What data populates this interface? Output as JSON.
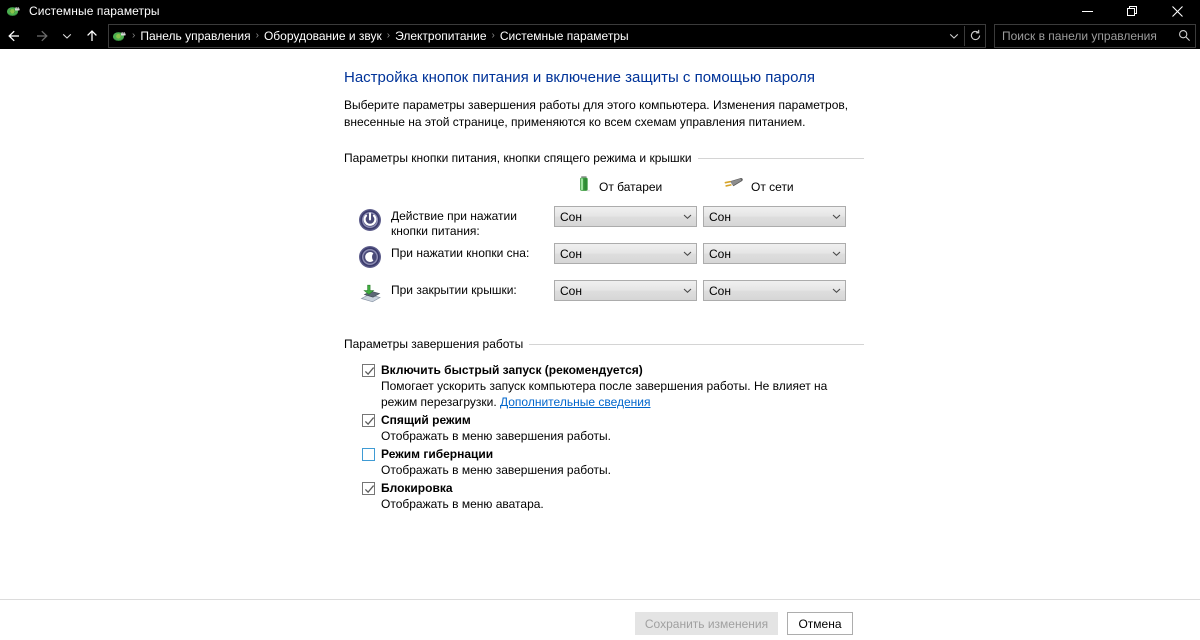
{
  "window": {
    "title": "Системные параметры",
    "icon": "power-options-icon",
    "caption": {
      "minimize": "minimize-icon",
      "maximize": "restore-icon",
      "close": "close-icon"
    }
  },
  "navbar": {
    "back": "back-arrow-icon",
    "forward": "forward-arrow-icon",
    "recent": "chevron-down-icon",
    "up": "up-arrow-icon",
    "address_icon": "power-options-icon",
    "breadcrumbs": [
      "Панель управления",
      "Оборудование и звук",
      "Электропитание",
      "Системные параметры"
    ],
    "separator": "›",
    "dropdown": "chevron-down-icon",
    "refresh": "refresh-icon",
    "search": {
      "placeholder": "Поиск в панели управления",
      "icon": "search-icon"
    }
  },
  "page": {
    "title": "Настройка кнопок питания и включение защиты с помощью пароля",
    "description": "Выберите параметры завершения работы для этого компьютера. Изменения параметров, внесенные на этой странице, применяются ко всем схемам управления питанием."
  },
  "power_buttons_group": {
    "header": "Параметры кнопки питания, кнопки спящего режима и крышки",
    "columns": [
      {
        "label": "От батареи",
        "icon": "battery-icon"
      },
      {
        "label": "От сети",
        "icon": "power-plug-icon"
      }
    ],
    "rows": [
      {
        "icon": "power-button-icon",
        "label": "Действие при нажатии кнопки питания:",
        "battery_value": "Сон",
        "plugged_value": "Сон"
      },
      {
        "icon": "sleep-button-icon",
        "label": "При нажатии кнопки сна:",
        "battery_value": "Сон",
        "plugged_value": "Сон"
      },
      {
        "icon": "laptop-lid-icon",
        "label": "При закрытии крышки:",
        "battery_value": "Сон",
        "plugged_value": "Сон"
      }
    ]
  },
  "shutdown_group": {
    "header": "Параметры завершения работы",
    "items": [
      {
        "label": "Включить быстрый запуск (рекомендуется)",
        "checked": true,
        "description_before": "Помогает ускорить запуск компьютера после завершения работы. Не влияет на режим перезагрузки. ",
        "link": "Дополнительные сведения"
      },
      {
        "label": "Спящий режим",
        "checked": true,
        "description_before": "Отображать в меню завершения работы.",
        "link": ""
      },
      {
        "label": "Режим гибернации",
        "checked": false,
        "description_before": "Отображать в меню завершения работы.",
        "link": ""
      },
      {
        "label": "Блокировка",
        "checked": true,
        "description_before": "Отображать в меню аватара.",
        "link": ""
      }
    ]
  },
  "footer": {
    "save_label": "Сохранить изменения",
    "save_disabled": true,
    "cancel_label": "Отмена"
  },
  "colors": {
    "title_link": "#003399",
    "hyperlink": "#0066cc",
    "titlebar_bg": "#000000",
    "checkbox_unchecked_border": "#3f9bd4",
    "battery_green": "#46b14b"
  }
}
